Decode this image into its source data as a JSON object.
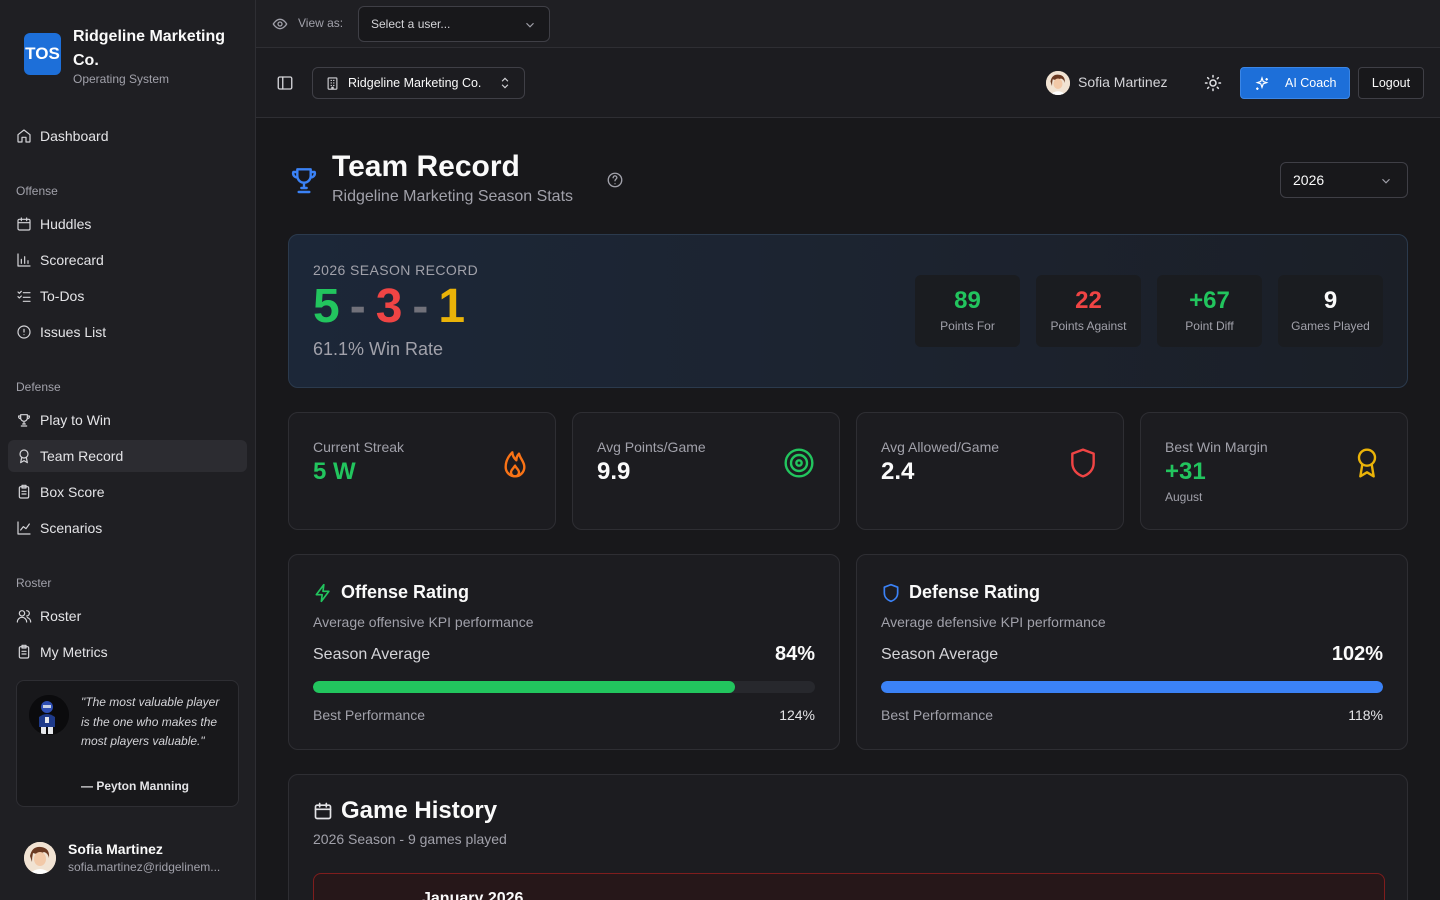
{
  "brand": {
    "logo_text": "TOS",
    "name": "Ridgeline Marketing Co.",
    "tagline": "Operating System"
  },
  "sidebar": {
    "dashboard": "Dashboard",
    "groups": {
      "offense": "Offense",
      "defense": "Defense",
      "roster": "Roster"
    },
    "offense_items": [
      "Huddles",
      "Scorecard",
      "To-Dos",
      "Issues List"
    ],
    "defense_items": [
      "Play to Win",
      "Team Record",
      "Box Score",
      "Scenarios"
    ],
    "roster_items": [
      "Roster",
      "My Metrics"
    ],
    "active_item": "Team Record",
    "quote": {
      "text": "\"The most valuable player is the one who makes the most players valuable.\"",
      "author": "— Peyton Manning"
    },
    "user": {
      "name": "Sofia Martinez",
      "email": "sofia.martinez@ridgelinem..."
    }
  },
  "viewbar": {
    "label": "View as:",
    "select_placeholder": "Select a user..."
  },
  "header": {
    "org": "Ridgeline Marketing Co.",
    "user_name": "Sofia Martinez",
    "ai_button": "AI Coach",
    "logout_button": "Logout"
  },
  "page": {
    "title": "Team Record",
    "subtitle": "Ridgeline Marketing Season Stats",
    "year": "2026"
  },
  "season": {
    "label": "2026 SEASON RECORD",
    "wins": "5",
    "losses": "3",
    "ties": "1",
    "dash": "-",
    "win_rate": "61.1% Win Rate",
    "stats": [
      {
        "value": "89",
        "label": "Points For",
        "color": "#22c55e"
      },
      {
        "value": "22",
        "label": "Points Against",
        "color": "#ef4444"
      },
      {
        "value": "+67",
        "label": "Point Diff",
        "color": "#22c55e"
      },
      {
        "value": "9",
        "label": "Games Played",
        "color": "#fafafa"
      }
    ]
  },
  "stat_cards": [
    {
      "label": "Current Streak",
      "value": "5 W",
      "sub": "",
      "icon": "flame-icon",
      "color": "#22c55e"
    },
    {
      "label": "Avg Points/Game",
      "value": "9.9",
      "sub": "",
      "icon": "target-icon",
      "color": "#fafafa"
    },
    {
      "label": "Avg Allowed/Game",
      "value": "2.4",
      "sub": "",
      "icon": "shield-icon",
      "color": "#fafafa"
    },
    {
      "label": "Best Win Margin",
      "value": "+31",
      "sub": "August",
      "icon": "award-icon",
      "color": "#22c55e"
    }
  ],
  "ratings": {
    "offense": {
      "title": "Offense Rating",
      "description": "Average offensive KPI performance",
      "avg_label": "Season Average",
      "avg_value": "84%",
      "progress": 0.84,
      "best_label": "Best Performance",
      "best_value": "124%",
      "color": "#22c55e"
    },
    "defense": {
      "title": "Defense Rating",
      "description": "Average defensive KPI performance",
      "avg_label": "Season Average",
      "avg_value": "102%",
      "progress": 1.0,
      "best_label": "Best Performance",
      "best_value": "118%",
      "color": "#3b82f6"
    }
  },
  "history": {
    "title": "Game History",
    "subtitle": "2026 Season - 9 games played",
    "first_month": "January 2026"
  },
  "colors": {
    "accent": "#1d6fd9",
    "win": "#22c55e",
    "loss": "#ef4444",
    "tie": "#eab308"
  }
}
